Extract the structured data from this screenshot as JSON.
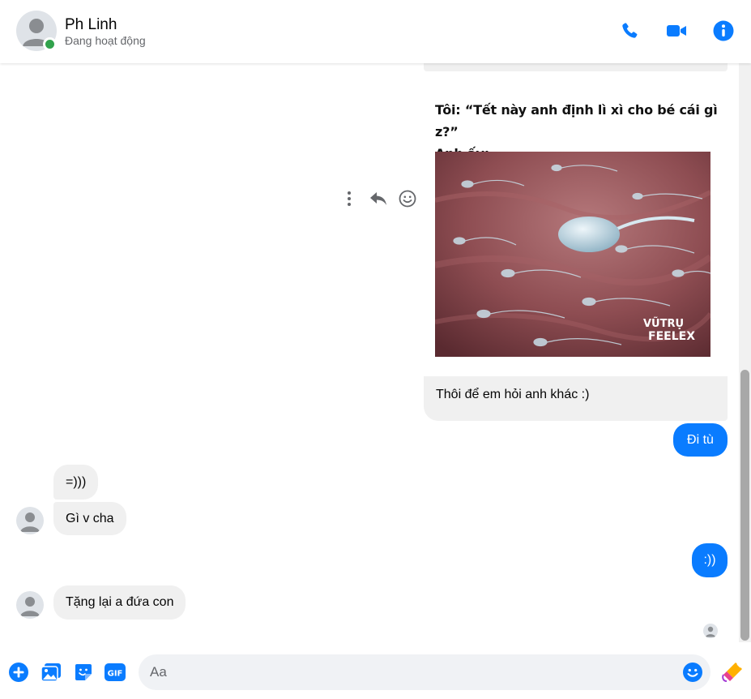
{
  "contact": {
    "name": "Ph Linh",
    "status": "Đang hoạt động"
  },
  "header": {
    "actions": [
      "phone-icon",
      "video-call-icon",
      "info-icon"
    ]
  },
  "colors": {
    "accent": "#0a7cff",
    "online": "#31a24c",
    "bubble_gray": "#f0f0f0"
  },
  "meme": {
    "caption_line1": "Tôi: “Tết này anh định lì xì cho bé cái gì z?”",
    "caption_line2": "Anh ấy:",
    "watermark_line1": "VŨTRỤ",
    "watermark_line2": "FEELEX"
  },
  "messages": [
    {
      "from": "contact_self_right",
      "text": "Thôi để em hỏi anh khác :)"
    },
    {
      "from": "me",
      "text": "Đi tù"
    },
    {
      "from": "contact",
      "text": "=)))"
    },
    {
      "from": "contact",
      "text": "Gì v cha"
    },
    {
      "from": "me",
      "text": ":))"
    },
    {
      "from": "contact",
      "text": "Tặng lại a đứa con"
    }
  ],
  "composer": {
    "placeholder": "Aa",
    "buttons": [
      "add-icon",
      "image-icon",
      "sticker-icon",
      "gif-icon"
    ],
    "gif_label": "GIF"
  }
}
